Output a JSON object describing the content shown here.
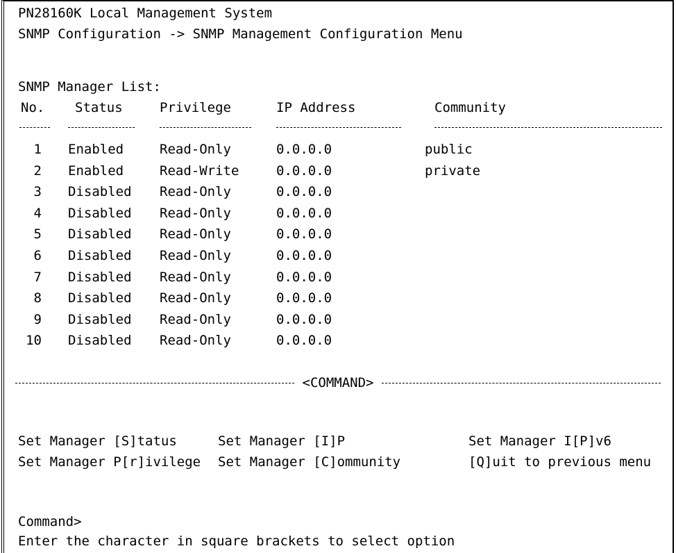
{
  "header": {
    "title": "PN28160K Local Management System",
    "breadcrumb": "SNMP Configuration -> SNMP Management Configuration Menu"
  },
  "list": {
    "caption": "SNMP Manager List:",
    "columns": {
      "no": "No.",
      "status": "Status",
      "privilege": "Privilege",
      "ip": "IP Address",
      "community": "Community"
    },
    "rows": [
      {
        "no": "1",
        "status": "Enabled",
        "privilege": "Read-Only",
        "ip": "0.0.0.0",
        "community": "public"
      },
      {
        "no": "2",
        "status": "Enabled",
        "privilege": "Read-Write",
        "ip": "0.0.0.0",
        "community": "private"
      },
      {
        "no": "3",
        "status": "Disabled",
        "privilege": "Read-Only",
        "ip": "0.0.0.0",
        "community": ""
      },
      {
        "no": "4",
        "status": "Disabled",
        "privilege": "Read-Only",
        "ip": "0.0.0.0",
        "community": ""
      },
      {
        "no": "5",
        "status": "Disabled",
        "privilege": "Read-Only",
        "ip": "0.0.0.0",
        "community": ""
      },
      {
        "no": "6",
        "status": "Disabled",
        "privilege": "Read-Only",
        "ip": "0.0.0.0",
        "community": ""
      },
      {
        "no": "7",
        "status": "Disabled",
        "privilege": "Read-Only",
        "ip": "0.0.0.0",
        "community": ""
      },
      {
        "no": "8",
        "status": "Disabled",
        "privilege": "Read-Only",
        "ip": "0.0.0.0",
        "community": ""
      },
      {
        "no": "9",
        "status": "Disabled",
        "privilege": "Read-Only",
        "ip": "0.0.0.0",
        "community": ""
      },
      {
        "no": "10",
        "status": "Disabled",
        "privilege": "Read-Only",
        "ip": "0.0.0.0",
        "community": ""
      }
    ]
  },
  "command_section": {
    "label": "<COMMAND>",
    "commands": [
      "Set Manager [S]tatus",
      "Set Manager [I]P",
      "Set Manager I[P]v6",
      "Set Manager P[r]ivilege",
      "Set Manager [C]ommunity",
      "[Q]uit to previous menu"
    ]
  },
  "prompt": {
    "label": "Command>",
    "hint": "Enter the character in square brackets to select option"
  },
  "colors": {
    "background": "#ffffff",
    "text": "#000000"
  }
}
